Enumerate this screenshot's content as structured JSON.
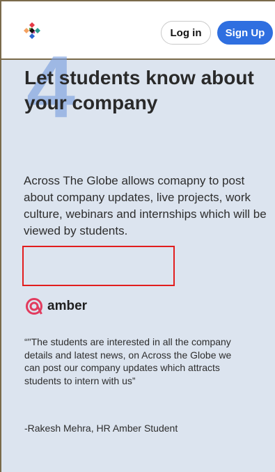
{
  "header": {
    "logo_icon": "across-the-globe-logo-icon",
    "login_label": "Log in",
    "signup_label": "Sign Up",
    "signup_color": "#2f6fe0"
  },
  "hero": {
    "step_number": "4",
    "title": "Let students know about your company",
    "description": "Across The Globe allows comapny to post about company updates, live projects, work culture, webinars and internships which will be viewed by students."
  },
  "testimonial": {
    "company_icon": "amber-logo-icon",
    "company_name": "amber",
    "quote": "“\"The students are interested in all the company details and latest news, on Across the Globe we can post our company updates which attracts students to intern with us”",
    "author": "-Rakesh Mehra, HR Amber Student"
  },
  "colors": {
    "background": "#dce4ef",
    "accent": "#7ea1df",
    "highlight_border": "#e21d1d",
    "brand_red": "#e23b5e"
  }
}
